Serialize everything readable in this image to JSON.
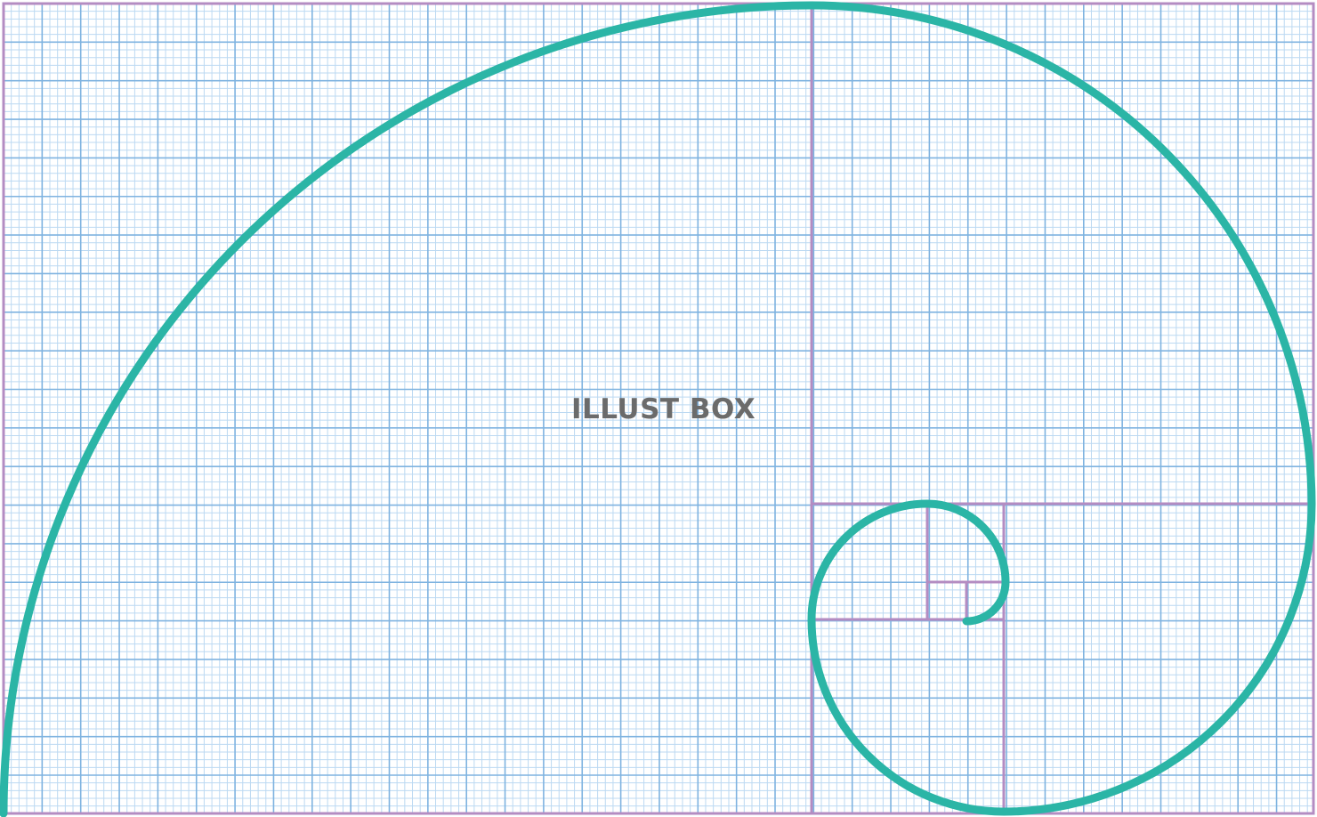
{
  "watermark": {
    "text": "ILLUST BOX",
    "color": "#6b6b6b"
  },
  "colors": {
    "grid_minor": "#bcd9f2",
    "grid_major": "#7fb3e0",
    "frame": "#b48cc2",
    "spiral": "#2bb5a6",
    "background": "#ffffff"
  },
  "icons": {
    "spiral": "golden-spiral-icon"
  }
}
